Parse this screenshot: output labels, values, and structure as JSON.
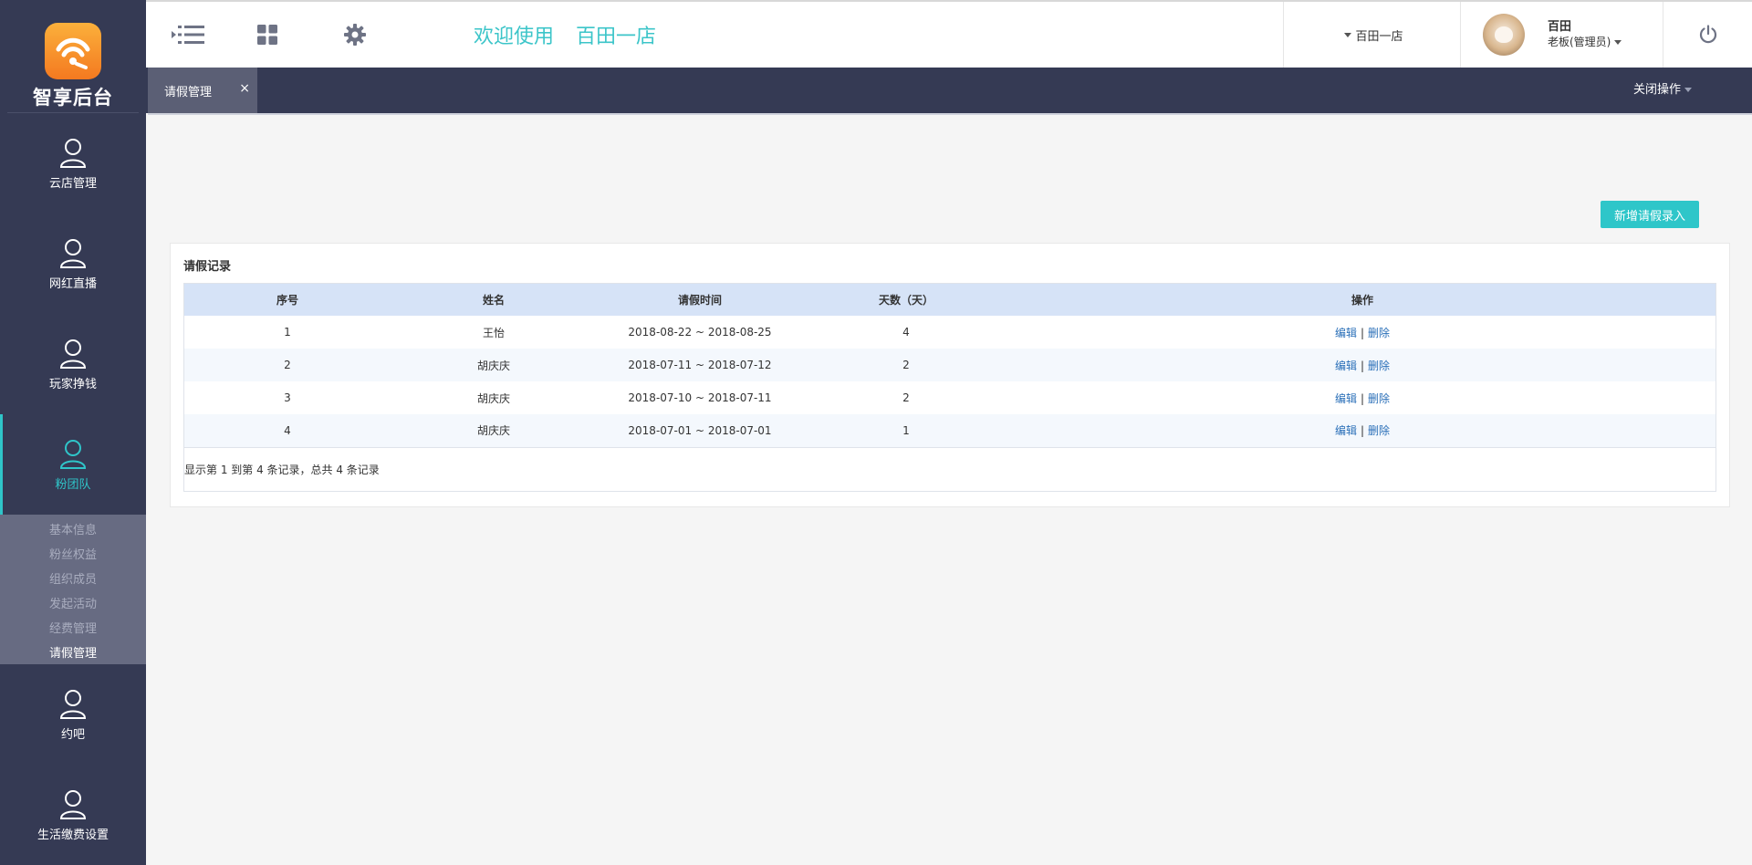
{
  "logo": {
    "text": "智享后台"
  },
  "sidebar": {
    "items": [
      {
        "label": "云店管理"
      },
      {
        "label": "网红直播"
      },
      {
        "label": "玩家挣钱"
      },
      {
        "label": "粉团队"
      }
    ],
    "submenu": [
      {
        "label": "基本信息"
      },
      {
        "label": "粉丝权益"
      },
      {
        "label": "组织成员"
      },
      {
        "label": "发起活动"
      },
      {
        "label": "经费管理"
      },
      {
        "label": "请假管理"
      }
    ],
    "items_after": [
      {
        "label": "约吧"
      },
      {
        "label": "生活缴费设置"
      }
    ]
  },
  "header": {
    "welcome": "欢迎使用",
    "store_name": "百田一店",
    "store_select": "百田一店",
    "user_name": "百田",
    "user_role": "老板(管理员)"
  },
  "tabs": {
    "active_label": "请假管理",
    "close_symbol": "×",
    "close_ops": "关闭操作"
  },
  "main": {
    "add_button": "新增请假录入",
    "panel_title": "请假记录",
    "columns": [
      "序号",
      "姓名",
      "请假时间",
      "天数（天）",
      "操作"
    ],
    "rows": [
      {
        "seq": "1",
        "name": "王怡",
        "time": "2018-08-22 ~ 2018-08-25",
        "days": "4"
      },
      {
        "seq": "2",
        "name": "胡庆庆",
        "time": "2018-07-11 ~ 2018-07-12",
        "days": "2"
      },
      {
        "seq": "3",
        "name": "胡庆庆",
        "time": "2018-07-10 ~ 2018-07-11",
        "days": "2"
      },
      {
        "seq": "4",
        "name": "胡庆庆",
        "time": "2018-07-01 ~ 2018-07-01",
        "days": "1"
      }
    ],
    "op_edit": "编辑",
    "op_sep": "|",
    "op_delete": "删除",
    "summary": "显示第 1 到第 4 条记录，总共 4 条记录"
  },
  "colors": {
    "accent": "#2ec6c9",
    "sidebar_bg": "#353a54",
    "submenu_bg": "#676b82",
    "table_header_bg": "#d6e3f7",
    "link": "#2a6fb8"
  }
}
